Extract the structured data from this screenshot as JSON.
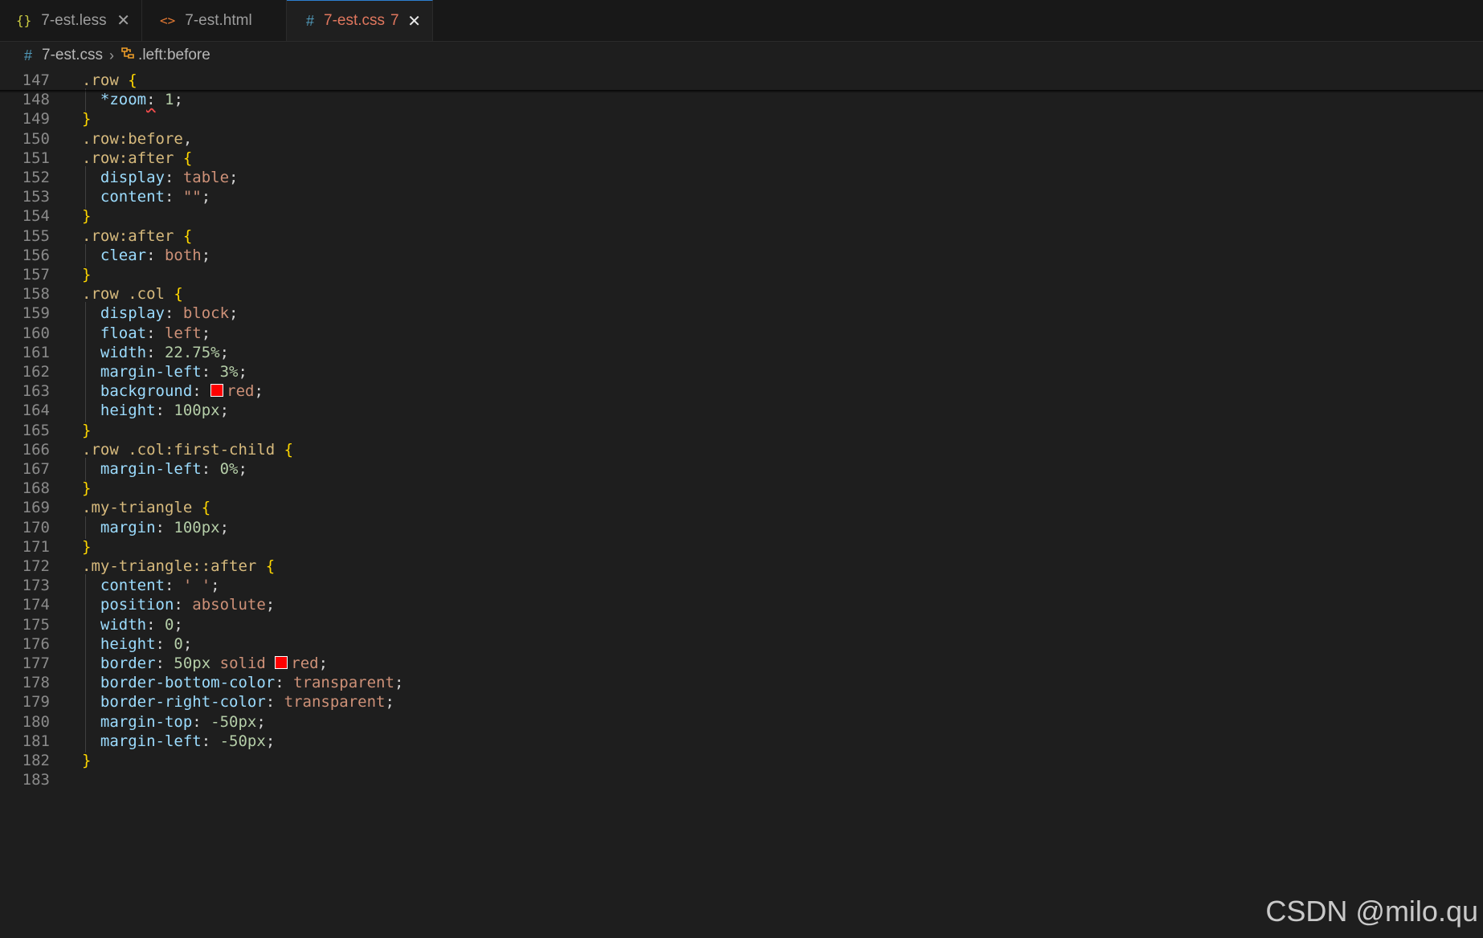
{
  "tabs": [
    {
      "icon": "{}",
      "label": "7-est.less",
      "close": "✕"
    },
    {
      "icon": "<>",
      "label": "7-est.html"
    },
    {
      "icon": "#",
      "label": "7-est.css",
      "problems": "7",
      "close": "✕"
    }
  ],
  "breadcrumb": {
    "file_icon": "#",
    "file": "7-est.css",
    "separator": "›",
    "symbol_icon": "symbol-class-icon",
    "symbol": ".left:before"
  },
  "lines": [
    {
      "n": "147",
      "tokens": [
        [
          "sel",
          ".row "
        ],
        [
          "brace",
          "{"
        ]
      ]
    },
    {
      "n": "148",
      "indent": true,
      "tokens": [
        [
          "prop",
          "  *zoom"
        ],
        [
          "squiggle",
          ":"
        ],
        [
          "punct",
          " "
        ],
        [
          "num",
          "1"
        ],
        [
          "punct",
          ";"
        ]
      ]
    },
    {
      "n": "149",
      "tokens": [
        [
          "brace",
          "}"
        ]
      ]
    },
    {
      "n": "150",
      "tokens": [
        [
          "sel",
          ".row:before"
        ],
        [
          "punct",
          ","
        ]
      ]
    },
    {
      "n": "151",
      "tokens": [
        [
          "sel",
          ".row:after "
        ],
        [
          "brace",
          "{"
        ]
      ]
    },
    {
      "n": "152",
      "indent": true,
      "tokens": [
        [
          "prop",
          "  display"
        ],
        [
          "punct",
          ": "
        ],
        [
          "val",
          "table"
        ],
        [
          "punct",
          ";"
        ]
      ]
    },
    {
      "n": "153",
      "indent": true,
      "tokens": [
        [
          "prop",
          "  content"
        ],
        [
          "punct",
          ": "
        ],
        [
          "val",
          "\"\""
        ],
        [
          "punct",
          ";"
        ]
      ]
    },
    {
      "n": "154",
      "tokens": [
        [
          "brace",
          "}"
        ]
      ]
    },
    {
      "n": "155",
      "tokens": [
        [
          "sel",
          ".row:after "
        ],
        [
          "brace",
          "{"
        ]
      ]
    },
    {
      "n": "156",
      "indent": true,
      "tokens": [
        [
          "prop",
          "  clear"
        ],
        [
          "punct",
          ": "
        ],
        [
          "val",
          "both"
        ],
        [
          "punct",
          ";"
        ]
      ]
    },
    {
      "n": "157",
      "tokens": [
        [
          "brace",
          "}"
        ]
      ]
    },
    {
      "n": "158",
      "tokens": [
        [
          "sel",
          ".row .col "
        ],
        [
          "brace",
          "{"
        ]
      ]
    },
    {
      "n": "159",
      "indent": true,
      "tokens": [
        [
          "prop",
          "  display"
        ],
        [
          "punct",
          ": "
        ],
        [
          "val",
          "block"
        ],
        [
          "punct",
          ";"
        ]
      ]
    },
    {
      "n": "160",
      "indent": true,
      "tokens": [
        [
          "prop",
          "  float"
        ],
        [
          "punct",
          ": "
        ],
        [
          "val",
          "left"
        ],
        [
          "punct",
          ";"
        ]
      ]
    },
    {
      "n": "161",
      "indent": true,
      "tokens": [
        [
          "prop",
          "  width"
        ],
        [
          "punct",
          ": "
        ],
        [
          "num",
          "22.75%"
        ],
        [
          "punct",
          ";"
        ]
      ]
    },
    {
      "n": "162",
      "indent": true,
      "tokens": [
        [
          "prop",
          "  margin-left"
        ],
        [
          "punct",
          ": "
        ],
        [
          "num",
          "3%"
        ],
        [
          "punct",
          ";"
        ]
      ]
    },
    {
      "n": "163",
      "indent": true,
      "tokens": [
        [
          "prop",
          "  background"
        ],
        [
          "punct",
          ": "
        ],
        [
          "swatch",
          ""
        ],
        [
          "val",
          "red"
        ],
        [
          "punct",
          ";"
        ]
      ]
    },
    {
      "n": "164",
      "indent": true,
      "tokens": [
        [
          "prop",
          "  height"
        ],
        [
          "punct",
          ": "
        ],
        [
          "num",
          "100px"
        ],
        [
          "punct",
          ";"
        ]
      ]
    },
    {
      "n": "165",
      "tokens": [
        [
          "brace",
          "}"
        ]
      ]
    },
    {
      "n": "166",
      "tokens": [
        [
          "sel",
          ".row .col:first-child "
        ],
        [
          "brace",
          "{"
        ]
      ]
    },
    {
      "n": "167",
      "indent": true,
      "tokens": [
        [
          "prop",
          "  margin-left"
        ],
        [
          "punct",
          ": "
        ],
        [
          "num",
          "0%"
        ],
        [
          "punct",
          ";"
        ]
      ]
    },
    {
      "n": "168",
      "tokens": [
        [
          "brace",
          "}"
        ]
      ]
    },
    {
      "n": "169",
      "tokens": [
        [
          "sel",
          ".my-triangle "
        ],
        [
          "brace",
          "{"
        ]
      ]
    },
    {
      "n": "170",
      "indent": true,
      "tokens": [
        [
          "prop",
          "  margin"
        ],
        [
          "punct",
          ": "
        ],
        [
          "num",
          "100px"
        ],
        [
          "punct",
          ";"
        ]
      ]
    },
    {
      "n": "171",
      "tokens": [
        [
          "brace",
          "}"
        ]
      ]
    },
    {
      "n": "172",
      "tokens": [
        [
          "sel",
          ".my-triangle::after "
        ],
        [
          "brace",
          "{"
        ]
      ]
    },
    {
      "n": "173",
      "indent": true,
      "tokens": [
        [
          "prop",
          "  content"
        ],
        [
          "punct",
          ": "
        ],
        [
          "val",
          "' '"
        ],
        [
          "punct",
          ";"
        ]
      ]
    },
    {
      "n": "174",
      "indent": true,
      "tokens": [
        [
          "prop",
          "  position"
        ],
        [
          "punct",
          ": "
        ],
        [
          "val",
          "absolute"
        ],
        [
          "punct",
          ";"
        ]
      ]
    },
    {
      "n": "175",
      "indent": true,
      "tokens": [
        [
          "prop",
          "  width"
        ],
        [
          "punct",
          ": "
        ],
        [
          "num",
          "0"
        ],
        [
          "punct",
          ";"
        ]
      ]
    },
    {
      "n": "176",
      "indent": true,
      "tokens": [
        [
          "prop",
          "  height"
        ],
        [
          "punct",
          ": "
        ],
        [
          "num",
          "0"
        ],
        [
          "punct",
          ";"
        ]
      ]
    },
    {
      "n": "177",
      "indent": true,
      "tokens": [
        [
          "prop",
          "  border"
        ],
        [
          "punct",
          ": "
        ],
        [
          "num",
          "50px"
        ],
        [
          "punct",
          " "
        ],
        [
          "val",
          "solid"
        ],
        [
          "punct",
          " "
        ],
        [
          "swatch",
          ""
        ],
        [
          "val",
          "red"
        ],
        [
          "punct",
          ";"
        ]
      ]
    },
    {
      "n": "178",
      "indent": true,
      "tokens": [
        [
          "prop",
          "  border-bottom-color"
        ],
        [
          "punct",
          ": "
        ],
        [
          "val",
          "transparent"
        ],
        [
          "punct",
          ";"
        ]
      ]
    },
    {
      "n": "179",
      "indent": true,
      "tokens": [
        [
          "prop",
          "  border-right-color"
        ],
        [
          "punct",
          ": "
        ],
        [
          "val",
          "transparent"
        ],
        [
          "punct",
          ";"
        ]
      ]
    },
    {
      "n": "180",
      "indent": true,
      "tokens": [
        [
          "prop",
          "  margin-top"
        ],
        [
          "punct",
          ": "
        ],
        [
          "num",
          "-50px"
        ],
        [
          "punct",
          ";"
        ]
      ]
    },
    {
      "n": "181",
      "indent": true,
      "tokens": [
        [
          "prop",
          "  margin-left"
        ],
        [
          "punct",
          ": "
        ],
        [
          "num",
          "-50px"
        ],
        [
          "punct",
          ";"
        ]
      ]
    },
    {
      "n": "182",
      "tokens": [
        [
          "brace",
          "}"
        ]
      ]
    },
    {
      "n": "183",
      "tokens": []
    }
  ],
  "colors": {
    "selector": "#d7ba7d",
    "property": "#9cdcfe",
    "value": "#ce9178",
    "number": "#b5cea8",
    "brace": "#ffd700",
    "swatch": "#ff0000"
  },
  "watermark": "CSDN @milo.qu"
}
